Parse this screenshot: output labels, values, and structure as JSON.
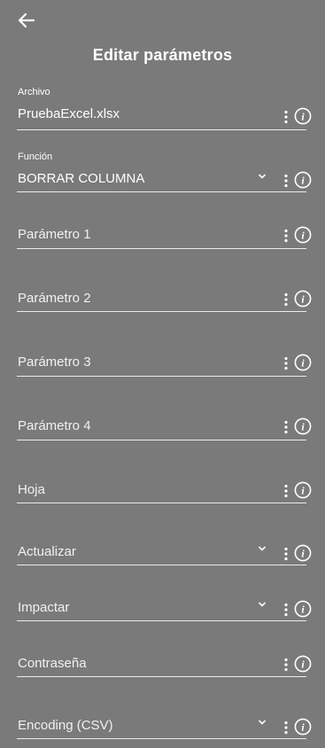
{
  "header": {
    "back_icon": "arrow-left-icon",
    "title": "Editar parámetros"
  },
  "fields": {
    "archivo": {
      "label": "Archivo",
      "value": "PruebaExcel.xlsx"
    },
    "funcion": {
      "label": "Función",
      "value": "BORRAR COLUMNA"
    },
    "parametro1": {
      "placeholder": "Parámetro 1"
    },
    "parametro2": {
      "placeholder": "Parámetro 2"
    },
    "parametro3": {
      "placeholder": "Parámetro 3"
    },
    "parametro4": {
      "placeholder": "Parámetro 4"
    },
    "hoja": {
      "placeholder": "Hoja"
    },
    "actualizar": {
      "placeholder": "Actualizar"
    },
    "impactar": {
      "placeholder": "Impactar"
    },
    "contrasena": {
      "placeholder": "Contraseña"
    },
    "encoding": {
      "placeholder": "Encoding (CSV)"
    }
  },
  "icons": {
    "more": "more-vertical-icon",
    "info": "info-icon",
    "dropdown": "chevron-down-icon"
  },
  "colors": {
    "background": "#7a7a7a",
    "text": "#ffffff",
    "underline": "#ececec"
  }
}
